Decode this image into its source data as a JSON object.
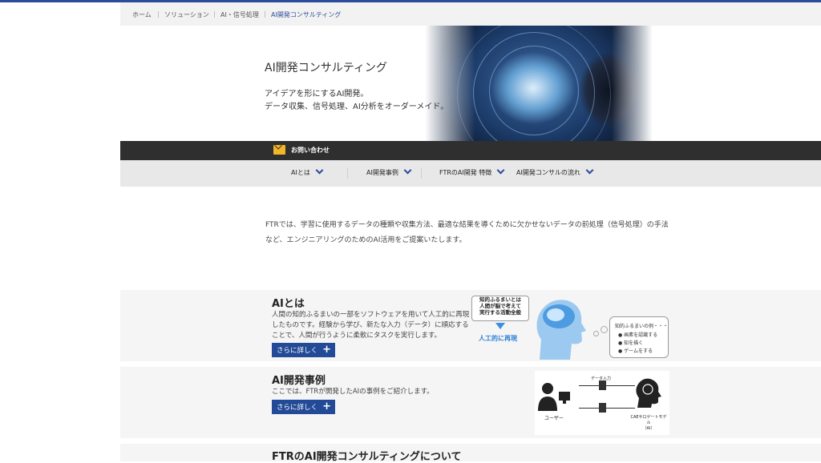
{
  "breadcrumb": {
    "items": [
      "ホーム",
      "ソリューション",
      "AI・信号処理",
      "AI開発コンサルティング"
    ]
  },
  "hero": {
    "title": "AI開発コンサルティング",
    "line1": "アイデアを形にするAI開発。",
    "line2": "データ収集、信号処理、AI分析をオーダーメイド。"
  },
  "contact": {
    "label": "お問い合わせ",
    "icon": "mail-icon"
  },
  "nav": {
    "items": [
      {
        "label": "AIとは"
      },
      {
        "label": "AI開発事例"
      },
      {
        "label": "FTRのAI開発 特徴"
      },
      {
        "label": "AI開発コンサルの流れ"
      }
    ]
  },
  "intro": {
    "line1": "FTRでは、学習に使用するデータの種類や収集方法、最適な結果を導くために欠かせないデータの前処理（信号処理）の手法",
    "line2": "など、エンジニアリングのためのAI活用をご提案いたします。"
  },
  "section_ai": {
    "title": "AIとは",
    "text1": "人間の知的ふるまいの一部をソフトウェアを用いて人工的に再現",
    "text2": "したものです。経験から学び、新たな入力（データ）に順応する",
    "text3": "ことで、人間が行うように柔軟にタスクを実行します。",
    "button": "さらに詳しく",
    "illus_bubble1": "知的ふるまいとは",
    "illus_bubble2": "人間が脳で考えて",
    "illus_bubble3": "実行する活動全般",
    "illus_label": "人工的に再現",
    "illus_list_title": "知的ふるまいの例・・・",
    "illus_list": [
      "画素を認識する",
      "知を描く",
      "ゲームをする"
    ]
  },
  "section_cases": {
    "title": "AI開発事例",
    "text1": "ここでは、FTRが開発したAIの事例をご紹介します。",
    "button": "さらに詳しく",
    "illus_user": "ユーザー",
    "illus_input": "データ入力",
    "illus_model": "CAEサロゲートモデル",
    "illus_model2": "（AI）"
  },
  "section_features": {
    "title": "FTRのAI開発コンサルティングについて"
  },
  "colors": {
    "accent": "#2b4c9a",
    "button": "#234a96",
    "mail": "#f3b52a",
    "bar": "#2f2f2f"
  }
}
